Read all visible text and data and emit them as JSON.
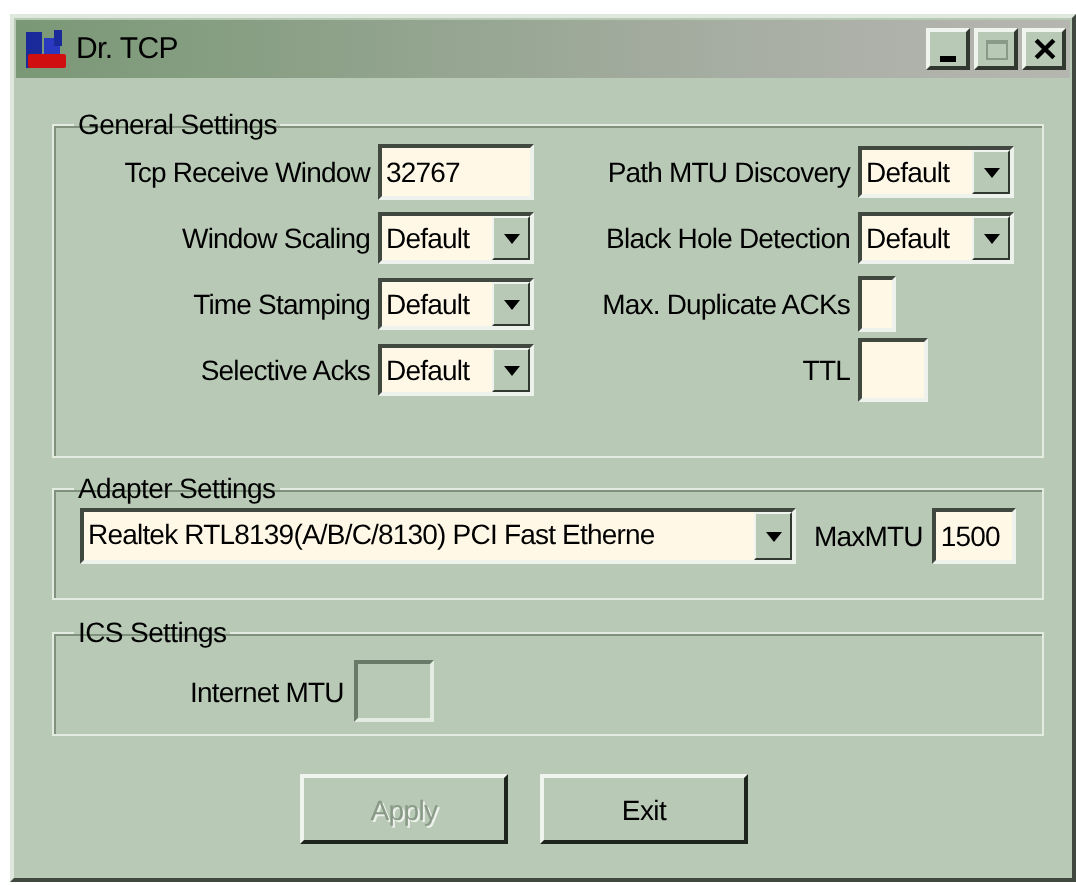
{
  "window": {
    "title": "Dr. TCP"
  },
  "general_settings": {
    "title": "General Settings",
    "left_fields": [
      {
        "label": "Tcp Receive Window",
        "kind": "text",
        "value": "32767"
      },
      {
        "label": "Window Scaling",
        "kind": "combo",
        "value": "Default"
      },
      {
        "label": "Time Stamping",
        "kind": "combo",
        "value": "Default"
      },
      {
        "label": "Selective Acks",
        "kind": "combo",
        "value": "Default"
      }
    ],
    "right_fields": [
      {
        "label": "Path MTU Discovery",
        "kind": "combo",
        "value": "Default"
      },
      {
        "label": "Black Hole Detection",
        "kind": "combo",
        "value": "Default"
      },
      {
        "label": "Max. Duplicate ACKs",
        "kind": "text"
      },
      {
        "label": "TTL",
        "kind": "text"
      }
    ]
  },
  "adapter_settings": {
    "title": "Adapter Settings",
    "adapter": {
      "value": "Realtek RTL8139(A/B/C/8130) PCI Fast Etherne"
    },
    "max_mtu": {
      "label": "MaxMTU",
      "value": "1500"
    }
  },
  "ics_settings": {
    "title": "ICS Settings",
    "internet_mtu": {
      "label": "Internet MTU",
      "disabled": true
    }
  },
  "buttons": [
    {
      "label": "Apply",
      "disabled": true
    },
    {
      "label": "Exit",
      "disabled": false
    }
  ]
}
